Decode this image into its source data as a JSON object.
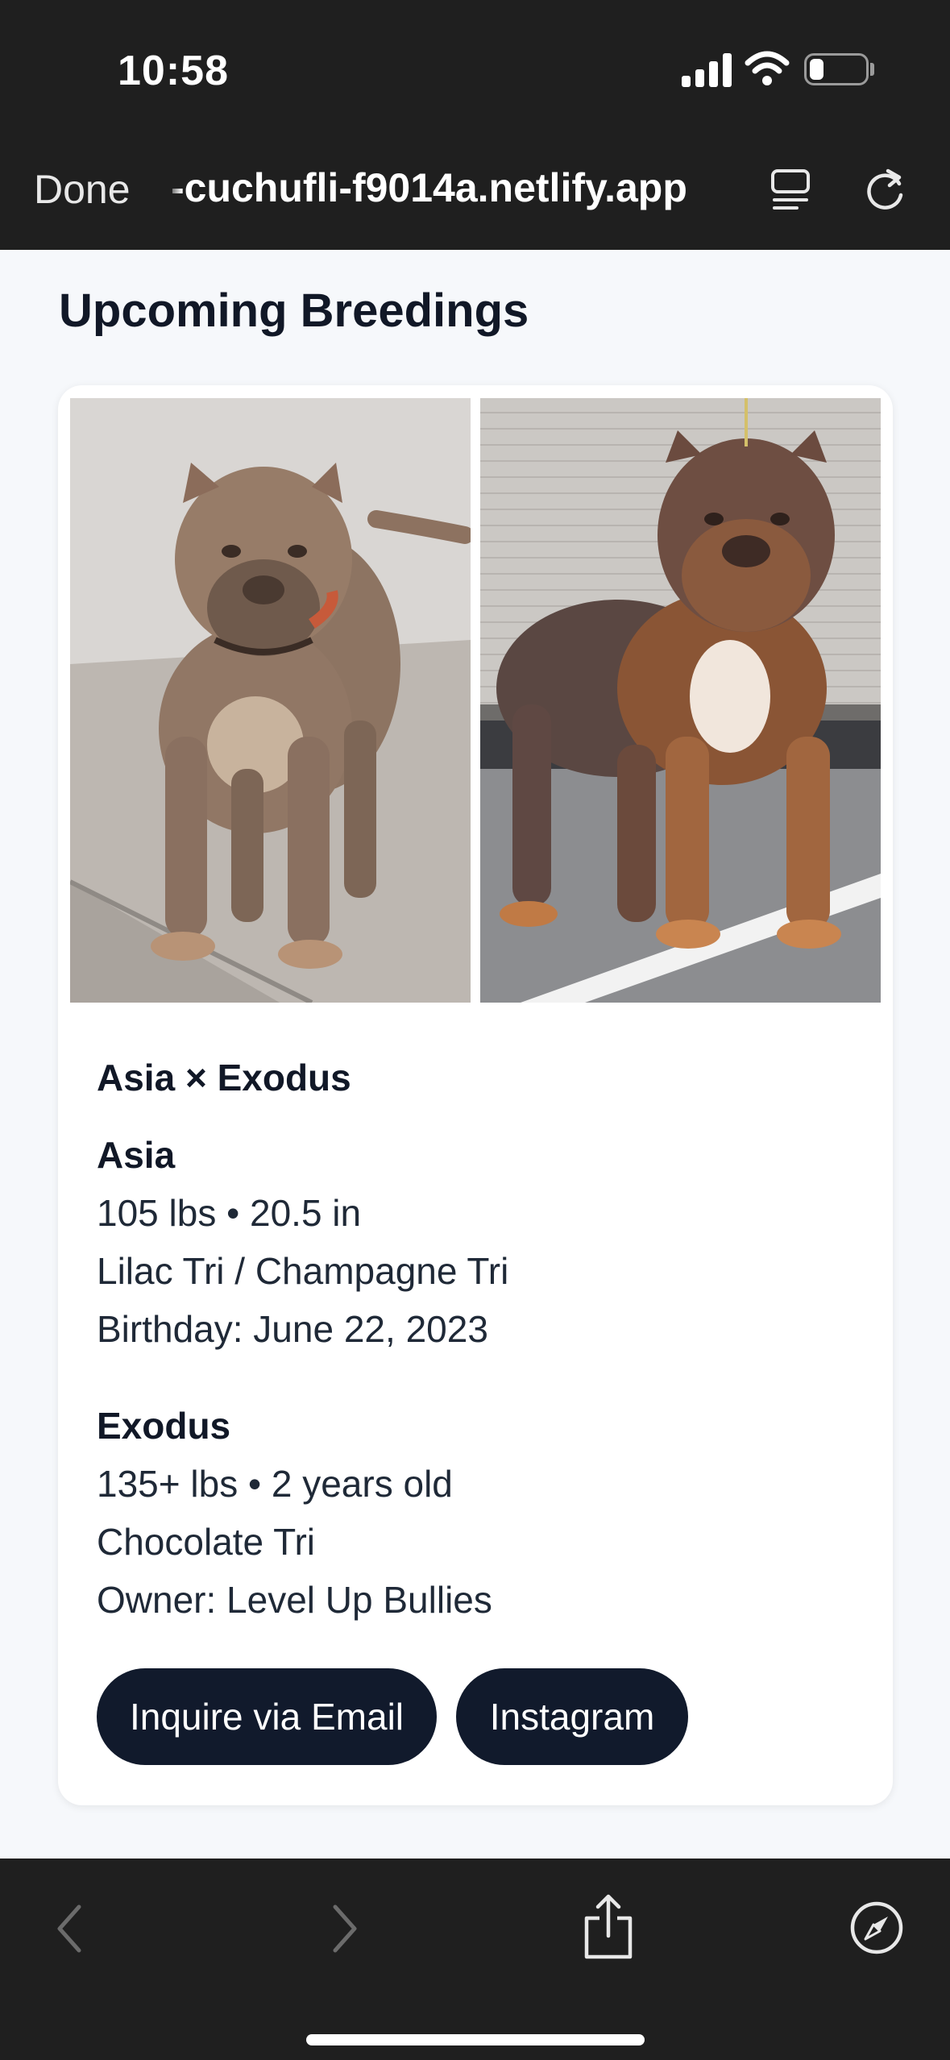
{
  "status_bar": {
    "time": "10:58",
    "battery_level": 0.25
  },
  "toolbar": {
    "done_label": "Done",
    "url": "-cuchufli-f9014a.netlify.app"
  },
  "page": {
    "heading": "Upcoming Breedings",
    "card": {
      "photos": [
        {
          "name": "Asia",
          "icon": "dog-photo"
        },
        {
          "name": "Exodus",
          "icon": "dog-photo"
        }
      ],
      "title": "Asia × Exodus",
      "dogs": [
        {
          "name": "Asia",
          "line1": "105 lbs • 20.5 in",
          "line2": "Lilac Tri / Champagne Tri",
          "line3": "Birthday: June 22, 2023"
        },
        {
          "name": "Exodus",
          "line1": "135+ lbs • 2 years old",
          "line2": "Chocolate Tri",
          "line3": "Owner: Level Up Bullies"
        }
      ],
      "buttons": {
        "email": "Inquire via Email",
        "instagram": "Instagram"
      }
    }
  },
  "colors": {
    "button_bg": "#111a2c",
    "chrome_bg": "#1f1f1f",
    "page_bg": "#f6f8fb"
  }
}
